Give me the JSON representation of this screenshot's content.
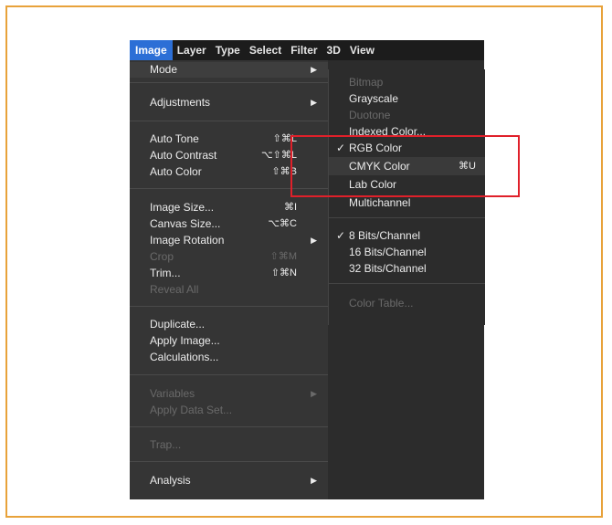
{
  "menubar": {
    "items": [
      "Image",
      "Layer",
      "Type",
      "Select",
      "Filter",
      "3D",
      "View"
    ]
  },
  "image_menu": {
    "items": [
      {
        "label": "Mode",
        "arrow": "▶"
      },
      {
        "label": "Adjustments",
        "arrow": "▶"
      },
      {
        "label": "Auto Tone",
        "shortcut": "⇧⌘L"
      },
      {
        "label": "Auto Contrast",
        "shortcut": "⌥⇧⌘L"
      },
      {
        "label": "Auto Color",
        "shortcut": "⇧⌘B"
      },
      {
        "label": "Image Size...",
        "shortcut": "⌘I"
      },
      {
        "label": "Canvas Size...",
        "shortcut": "⌥⌘C"
      },
      {
        "label": "Image Rotation",
        "arrow": "▶"
      },
      {
        "label": "Crop",
        "shortcut": "⇧⌘M"
      },
      {
        "label": "Trim...",
        "shortcut": "⇧⌘N"
      },
      {
        "label": "Reveal All"
      },
      {
        "label": "Duplicate..."
      },
      {
        "label": "Apply Image..."
      },
      {
        "label": "Calculations..."
      },
      {
        "label": "Variables",
        "arrow": "▶"
      },
      {
        "label": "Apply Data Set..."
      },
      {
        "label": "Trap..."
      },
      {
        "label": "Analysis",
        "arrow": "▶"
      }
    ]
  },
  "mode_submenu": {
    "items": [
      {
        "label": "Bitmap"
      },
      {
        "label": "Grayscale"
      },
      {
        "label": "Duotone"
      },
      {
        "label": "Indexed Color..."
      },
      {
        "label": "RGB Color",
        "check": "✓"
      },
      {
        "label": "CMYK Color",
        "shortcut": "⌘U"
      },
      {
        "label": "Lab Color"
      },
      {
        "label": "Multichannel"
      },
      {
        "label": "8 Bits/Channel",
        "check": "✓"
      },
      {
        "label": "16 Bits/Channel"
      },
      {
        "label": "32 Bits/Channel"
      },
      {
        "label": "Color Table..."
      }
    ]
  },
  "colors": {
    "frame_border": "#e8a23a",
    "callout_border": "#e0202a",
    "active_menu": "#2c6fd6"
  }
}
